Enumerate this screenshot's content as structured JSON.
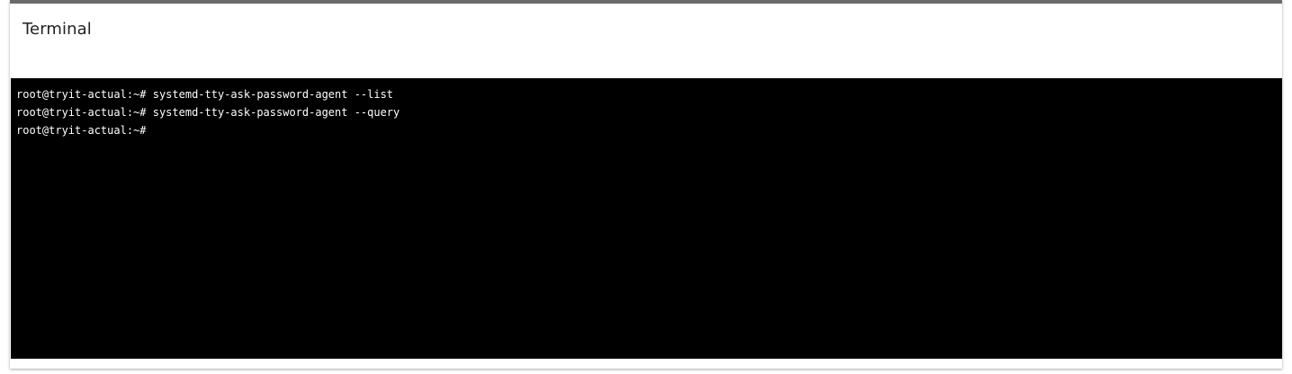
{
  "panel": {
    "title": "Terminal"
  },
  "terminal": {
    "lines": [
      {
        "prompt": "root@tryit-actual:~#",
        "command": " systemd-tty-ask-password-agent --list"
      },
      {
        "prompt": "root@tryit-actual:~#",
        "command": " systemd-tty-ask-password-agent --query"
      },
      {
        "prompt": "root@tryit-actual:~#",
        "command": ""
      }
    ],
    "colors": {
      "background": "#000000",
      "foreground": "#ffffff"
    }
  }
}
